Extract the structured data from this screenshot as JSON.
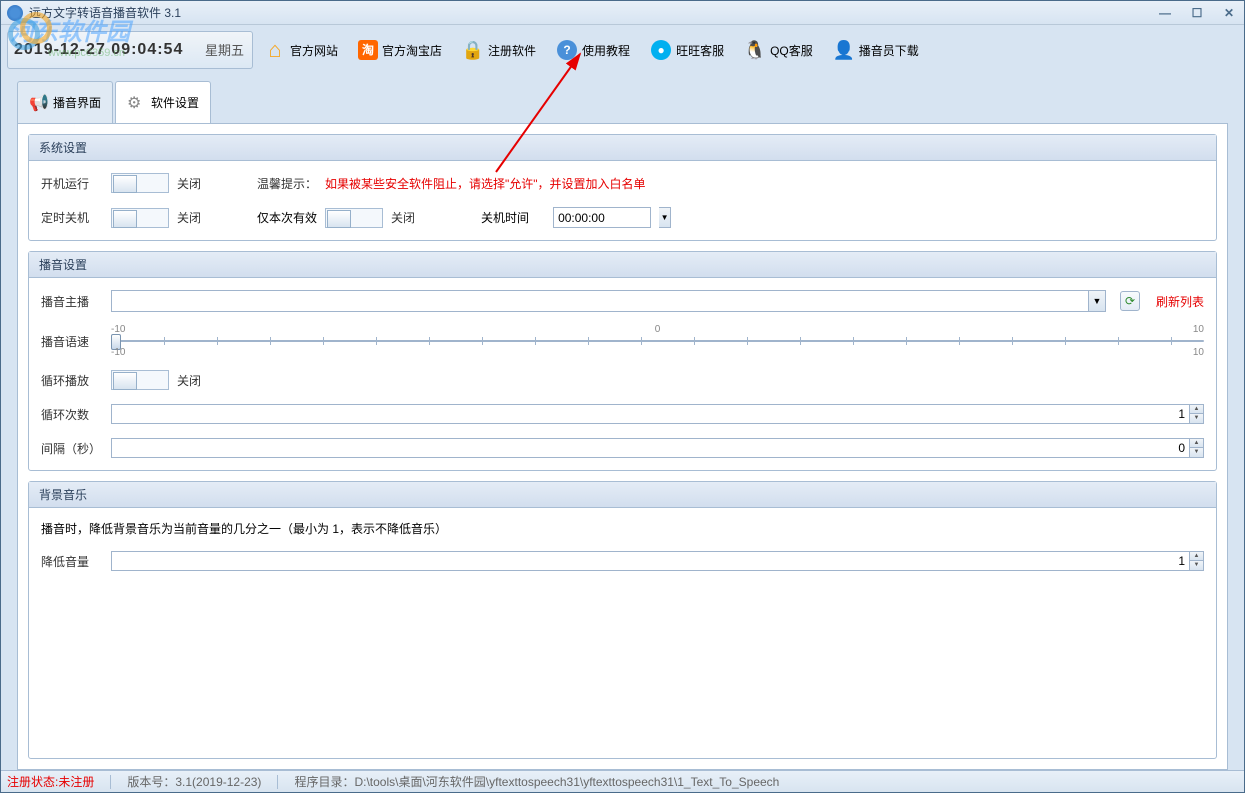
{
  "window": {
    "title": "远方文字转语音播音软件 3.1"
  },
  "datetime": {
    "datetime_full": "2019-12-27 09:04:54",
    "weekday": "星期五"
  },
  "toolbar": {
    "official_site": "官方网站",
    "taobao_shop": "官方淘宝店",
    "register": "注册软件",
    "tutorial": "使用教程",
    "ww_service": "旺旺客服",
    "qq_service": "QQ客服",
    "announcer_dl": "播音员下载"
  },
  "tabs": {
    "broadcast": "播音界面",
    "settings": "软件设置"
  },
  "groups": {
    "system": {
      "title": "系统设置",
      "boot_run": "开机运行",
      "off_label": "关闭",
      "timed_shutdown": "定时关机",
      "once_only": "仅本次有效",
      "shutdown_time": "关机时间",
      "time_value": "00:00:00",
      "warn_prefix": "温馨提示：",
      "warn_text": "如果被某些安全软件阻止，请选择\"允许\"，并设置加入白名单"
    },
    "broadcast": {
      "title": "播音设置",
      "anchor": "播音主播",
      "refresh": "刷新列表",
      "speed": "播音语速",
      "min_top": "-10",
      "max_top": "10",
      "zero": "0",
      "min_bot": "-10",
      "max_bot": "10",
      "loop": "循环播放",
      "loop_count": "循环次数",
      "loop_count_val": "1",
      "interval": "间隔（秒）",
      "interval_val": "0"
    },
    "bgm": {
      "title": "背景音乐",
      "desc": "播音时，降低背景音乐为当前音量的几分之一（最小为 1，表示不降低音乐）",
      "reduce_vol": "降低音量",
      "reduce_val": "1"
    }
  },
  "status": {
    "reg_label": "注册状态:",
    "reg_value": "未注册",
    "version_label": "版本号：",
    "version_value": "3.1(2019-12-23)",
    "dir_label": "程序目录：",
    "dir_value": "D:\\tools\\桌面\\河东软件园\\yftexttospeech31\\yftexttospeech31\\1_Text_To_Speech"
  },
  "watermark": {
    "name": "河东软件园",
    "url": "www.pc0359.cn"
  },
  "icons": {
    "tao": "淘"
  }
}
